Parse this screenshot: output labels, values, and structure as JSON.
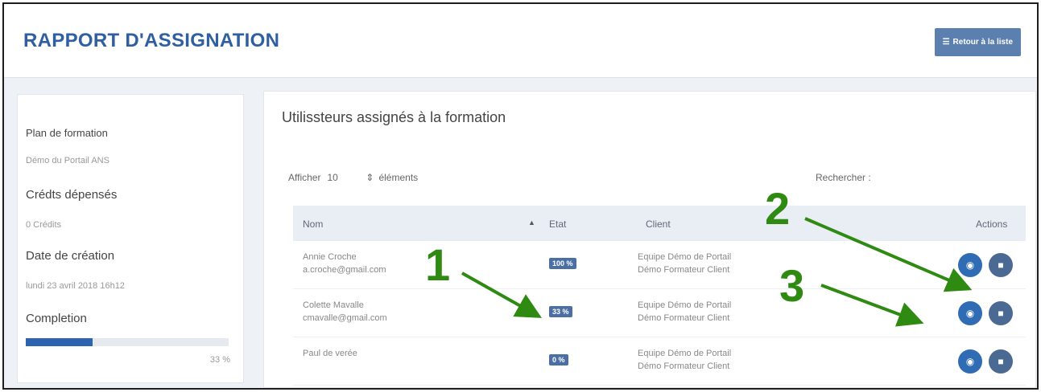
{
  "header": {
    "title": "RAPPORT D'ASSIGNATION",
    "back_label": "Retour à la liste"
  },
  "sidebar": {
    "plan_label": "Plan de formation",
    "plan_value": "Démo du Portail ANS",
    "credits_label": "Crédts dépensés",
    "credits_value": "0 Crédits",
    "date_label": "Date de création",
    "date_value": "lundi 23 avril 2018 16h12",
    "completion_label": "Completion",
    "completion_pct": "33 %",
    "completion_fraction": 0.33
  },
  "main": {
    "title": "Utilissteurs assignés à la formation",
    "show_label": "Afficher",
    "show_value": "10",
    "show_after": "éléments",
    "search_label": "Rechercher :",
    "columns": {
      "nom": "Nom",
      "etat": "Etat",
      "client": "Client",
      "actions": "Actions"
    },
    "rows": [
      {
        "name": "Annie Croche",
        "email": "a.croche@gmail.com",
        "state": "100 %",
        "client_line1": "Equipe Démo de Portail",
        "client_line2": "Démo Formateur Client"
      },
      {
        "name": "Colette Mavalle",
        "email": "cmavalle@gmail.com",
        "state": "33 %",
        "client_line1": "Equipe Démo de Portail",
        "client_line2": "Démo Formateur Client"
      },
      {
        "name": "Paul de verée",
        "email": "",
        "state": "0 %",
        "client_line1": "Equipe Démo de Portail",
        "client_line2": "Démo Formateur Client"
      }
    ]
  },
  "callouts": {
    "one": "1",
    "two": "2",
    "three": "3"
  },
  "colors": {
    "accent": "#2f5fa0",
    "callout": "#2f8a12"
  }
}
